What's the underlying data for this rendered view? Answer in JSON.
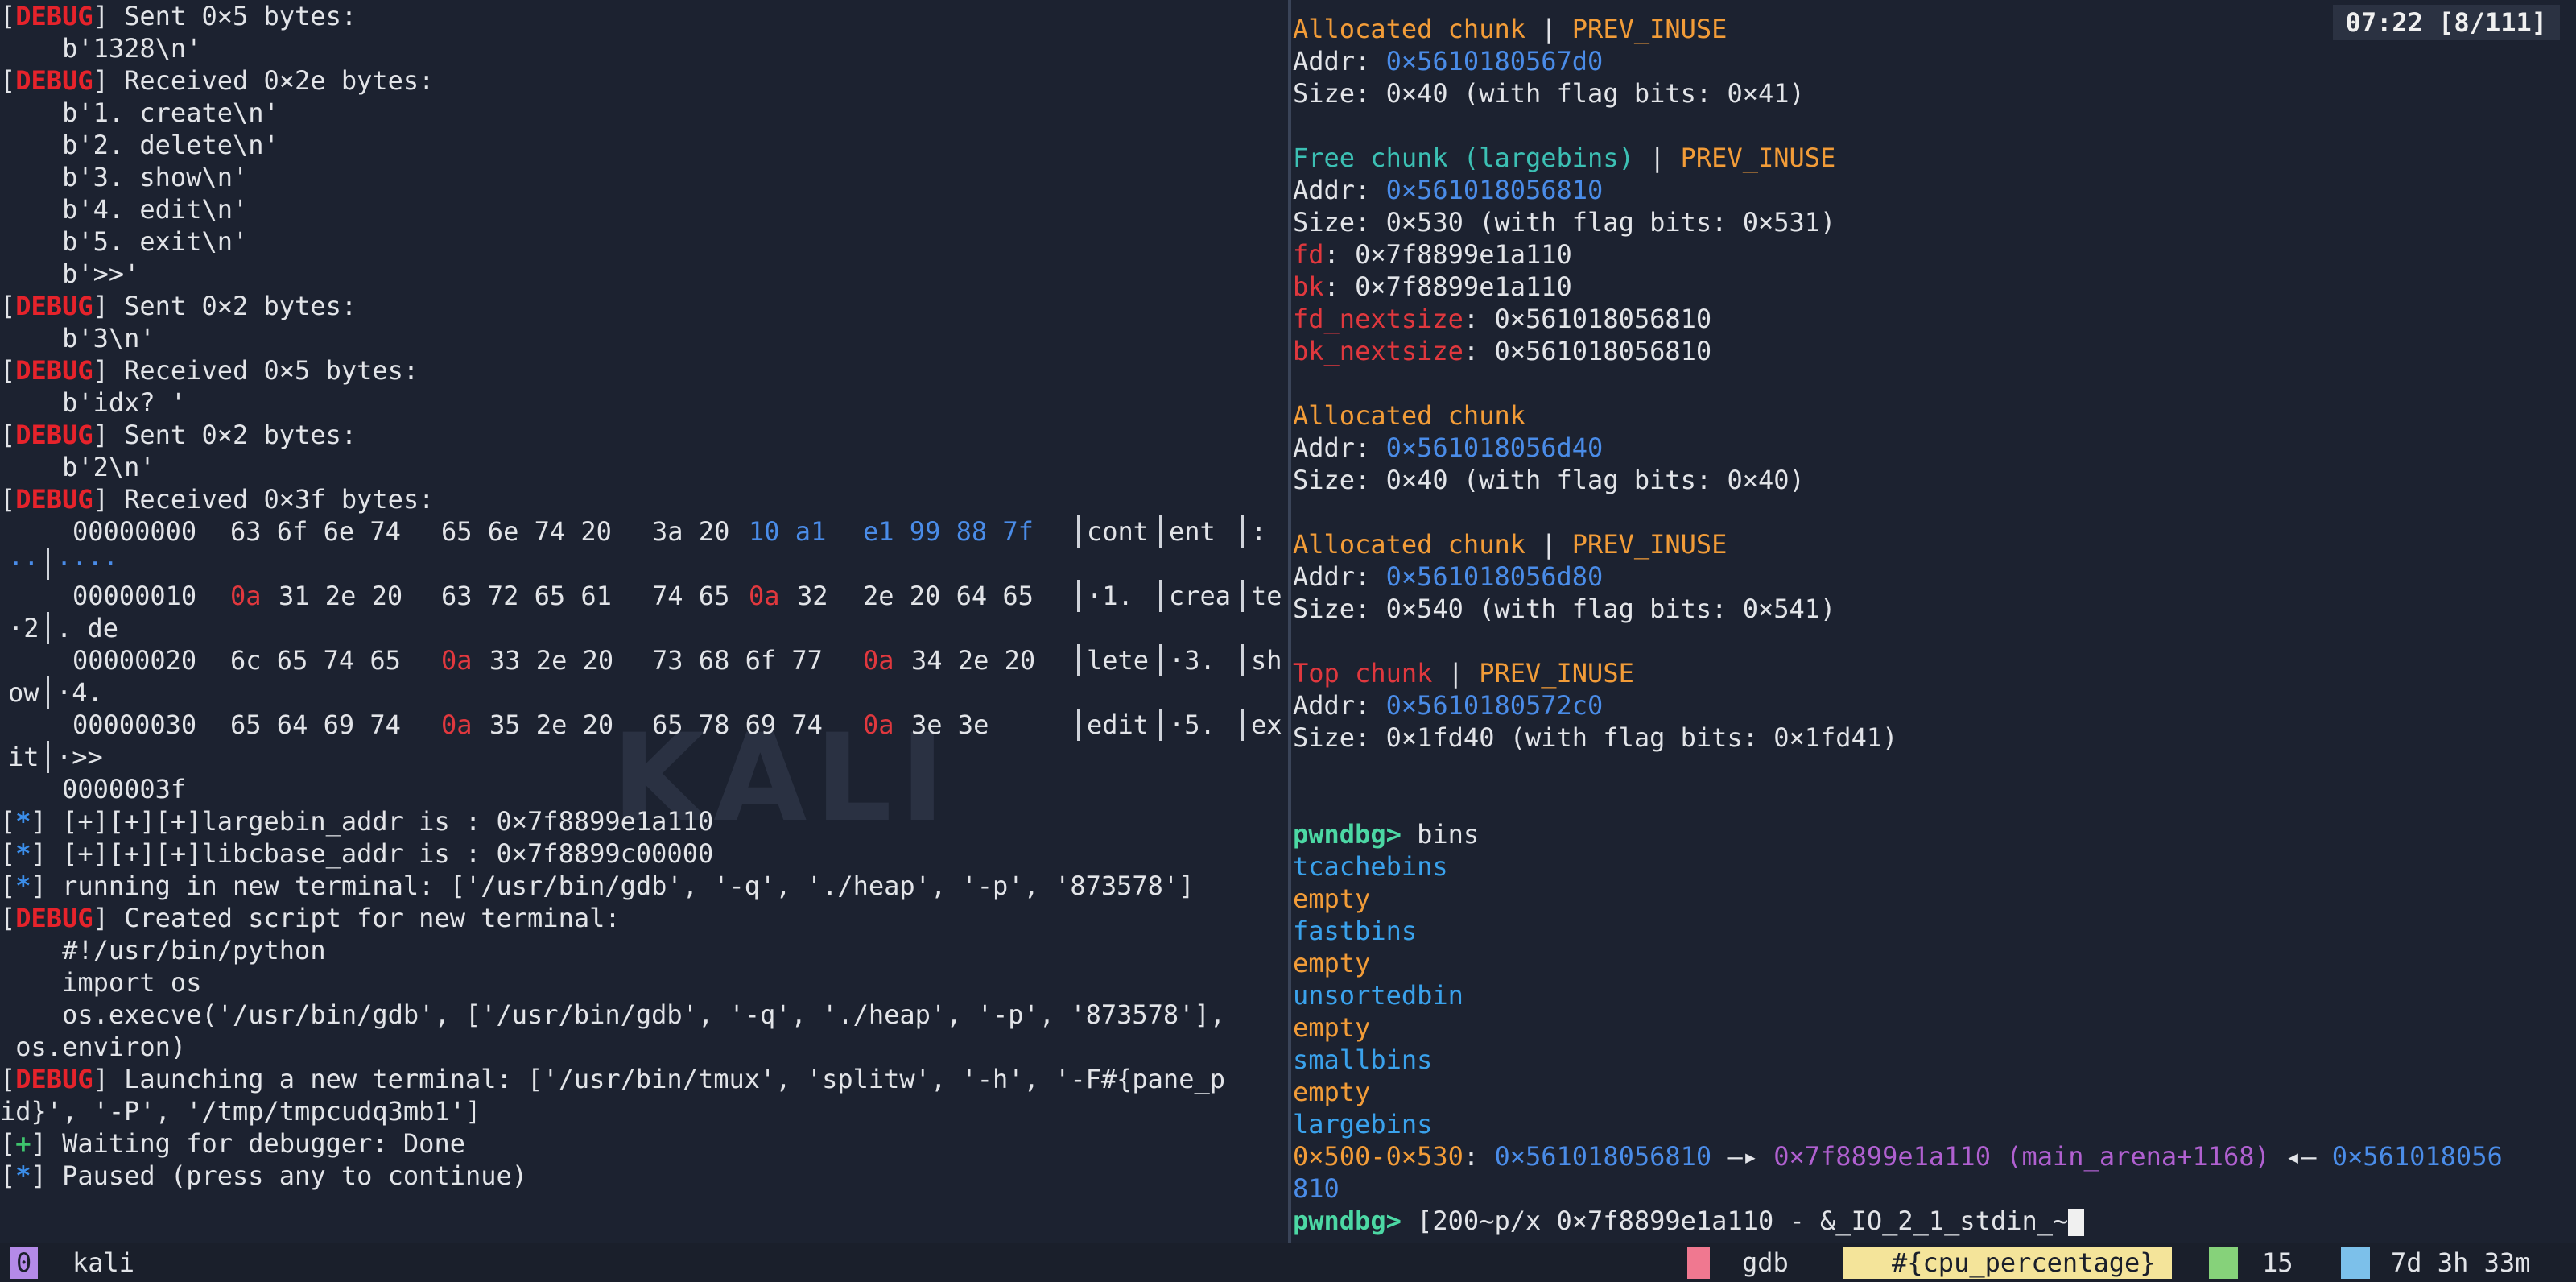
{
  "left_pane": {
    "lines_top": [
      {
        "tag": "DEBUG",
        "text": " Sent 0×5 bytes:"
      },
      {
        "text": "    b'1328\\n'"
      },
      {
        "tag": "DEBUG",
        "text": " Received 0×2e bytes:"
      },
      {
        "text": "    b'1. create\\n'"
      },
      {
        "text": "    b'2. delete\\n'"
      },
      {
        "text": "    b'3. show\\n'"
      },
      {
        "text": "    b'4. edit\\n'"
      },
      {
        "text": "    b'5. exit\\n'"
      },
      {
        "text": "    b'>>'"
      },
      {
        "tag": "DEBUG",
        "text": " Sent 0×2 bytes:"
      },
      {
        "text": "    b'3\\n'"
      },
      {
        "tag": "DEBUG",
        "text": " Received 0×5 bytes:"
      },
      {
        "text": "    b'idx? '"
      },
      {
        "tag": "DEBUG",
        "text": " Sent 0×2 bytes:"
      },
      {
        "text": "    b'2\\n'"
      },
      {
        "tag": "DEBUG",
        "text": " Received 0×3f bytes:"
      }
    ],
    "hexdump": [
      {
        "offset": "00000000",
        "g1": "63 6f 6e 74",
        "g2": "65 6e 74 20",
        "g3": "3a 20",
        "g3b": "10 a1",
        "g4": "e1 99 88 7f",
        "a1": "cont",
        "a2": "ent ",
        "a3": ":",
        "wrap": "··",
        "wrap2": "····"
      },
      {
        "offset": "00000010",
        "g1a": "0a",
        "g1": "31 2e 20",
        "g2": "63 72 65 61",
        "g3": "74 65",
        "g3r": "0a",
        "g3c": "32",
        "g4": "2e 20 64 65",
        "a1": "·1. ",
        "a2": "crea",
        "a3": "te",
        "wrap": "·2",
        "wrap2": ". de"
      },
      {
        "offset": "00000020",
        "g1": "6c 65 74 65",
        "g2a": "0a",
        "g2": "33 2e 20",
        "g3": "73 68 6f 77",
        "g4a": "0a",
        "g4": "34 2e 20",
        "a1": "lete",
        "a2": "·3. ",
        "a3": "sh",
        "wrap": "ow",
        "wrap2": "·4. "
      },
      {
        "offset": "00000030",
        "g1": "65 64 69 74",
        "g2a": "0a",
        "g2": "35 2e 20",
        "g3": "65 78 69 74",
        "g4a": "0a",
        "g4": "3e 3e",
        "a1": "edit",
        "a2": "·5. ",
        "a3": "ex",
        "wrap": "it",
        "wrap2": "·>>"
      }
    ],
    "hex_end": "    0000003f",
    "lines_bottom": [
      {
        "tag": "*",
        "text": " [+][+][+]largebin_addr is : 0×7f8899e1a110"
      },
      {
        "tag": "*",
        "text": " [+][+][+]libcbase_addr is : 0×7f8899c00000"
      },
      {
        "tag": "*",
        "text": " running in new terminal: ['/usr/bin/gdb', '-q', './heap', '-p', '873578']"
      },
      {
        "tag": "DEBUG",
        "text": " Created script for new terminal:"
      },
      {
        "text": "    #!/usr/bin/python"
      },
      {
        "text": "    import os"
      },
      {
        "text": "    os.execve('/usr/bin/gdb', ['/usr/bin/gdb', '-q', './heap', '-p', '873578'],"
      },
      {
        "text": " os.environ)"
      },
      {
        "tag": "DEBUG",
        "text": " Launching a new terminal: ['/usr/bin/tmux', 'splitw', '-h', '-F#{pane_p"
      },
      {
        "text": "id}', '-P', '/tmp/tmpcudq3mb1']"
      },
      {
        "tag": "+",
        "text": " Waiting for debugger: Done"
      },
      {
        "tag": "*",
        "text": " Paused (press any to continue)"
      }
    ]
  },
  "right_pane": {
    "clock": "07:22 [8/111]",
    "chunks": [
      {
        "kind": "Allocated chunk",
        "flag": "PREV_INUSE",
        "addr": "0×5610180567d0",
        "size": "0×40 (with flag bits: 0×41)"
      },
      {
        "kind": "Free chunk (largebins)",
        "flag": "PREV_INUSE",
        "addr": "0×561018056810",
        "size": "0×530 (with flag bits: 0×531)",
        "fd": "0×7f8899e1a110",
        "bk": "0×7f8899e1a110",
        "fd_nextsize": "0×561018056810",
        "bk_nextsize": "0×561018056810"
      },
      {
        "kind": "Allocated chunk",
        "flag": "",
        "addr": "0×561018056d40",
        "size": "0×40 (with flag bits: 0×40)"
      },
      {
        "kind": "Allocated chunk",
        "flag": "PREV_INUSE",
        "addr": "0×561018056d80",
        "size": "0×540 (with flag bits: 0×541)"
      },
      {
        "kind": "Top chunk",
        "flag": "PREV_INUSE",
        "addr": "0×5610180572c0",
        "size": "0×1fd40 (with flag bits: 0×1fd41)"
      }
    ],
    "labels": {
      "addr": "Addr: ",
      "size": "Size: ",
      "sep": " | ",
      "fd": "fd",
      "bk": "bk",
      "fd_nextsize": "fd_nextsize",
      "bk_nextsize": "bk_nextsize",
      "colon": ": "
    },
    "prompt": "pwndbg>",
    "bins_cmd": " bins",
    "bins": [
      {
        "name": "tcachebins",
        "value": "empty"
      },
      {
        "name": "fastbins",
        "value": "empty"
      },
      {
        "name": "unsortedbin",
        "value": "empty"
      },
      {
        "name": "smallbins",
        "value": "empty"
      },
      {
        "name": "largebins",
        "value": ""
      }
    ],
    "largebin_entry": {
      "range": "0×500-0×530",
      "colon": ": ",
      "a1": "0×561018056810",
      "arrow1": " —▸ ",
      "a2": "0×7f8899e1a110 (main_arena+1168)",
      "arrow2": " ◂— ",
      "a3": "0×561018056",
      "wrap": "810"
    },
    "input": " [200~p/x 0×7f8899e1a110 - &_IO_2_1_stdin_~"
  },
  "status_bar": {
    "window_index": "0",
    "session": "kali",
    "right_items": [
      "gdb",
      "#{cpu_percentage}",
      "15",
      "7d 3h 33m"
    ]
  },
  "colors": {
    "accent_debug": "#e6232b",
    "accent_info": "#3b8eea",
    "accent_ok": "#3ec46d",
    "prompt": "#4cd8a4",
    "address": "#4a8ce8",
    "chunk_label": "#f29c38"
  }
}
